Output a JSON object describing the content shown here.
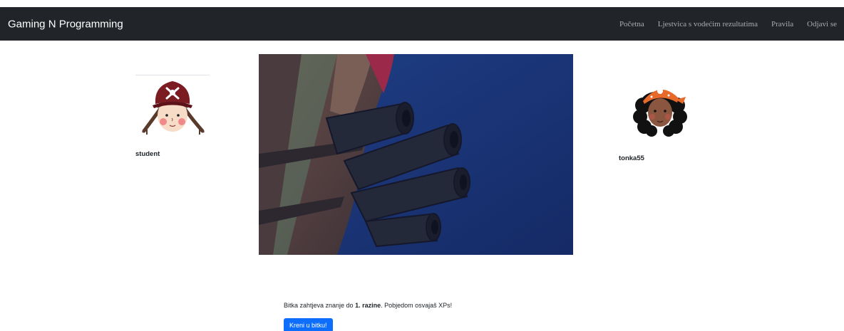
{
  "navbar": {
    "brand": "Gaming N Programming",
    "links": [
      "Početna",
      "Ljestvica s vodećim rezultatima",
      "Pravila",
      "Odjavi se"
    ],
    "background": "#212529"
  },
  "players": {
    "left": {
      "username": "student",
      "avatar": "pirate-girl-avatar"
    },
    "right": {
      "username": "tonka55",
      "avatar": "pirate-curly-avatar"
    }
  },
  "battle": {
    "image": "pirate-ship-cannons-image",
    "info_prefix": "Bitka zahtjeva znanje do ",
    "info_level": "1. razine",
    "info_suffix": ". Pobjedom osvajaš XPs!",
    "button_label": "Kreni u bitku!",
    "button_color": "#0d6efd"
  }
}
